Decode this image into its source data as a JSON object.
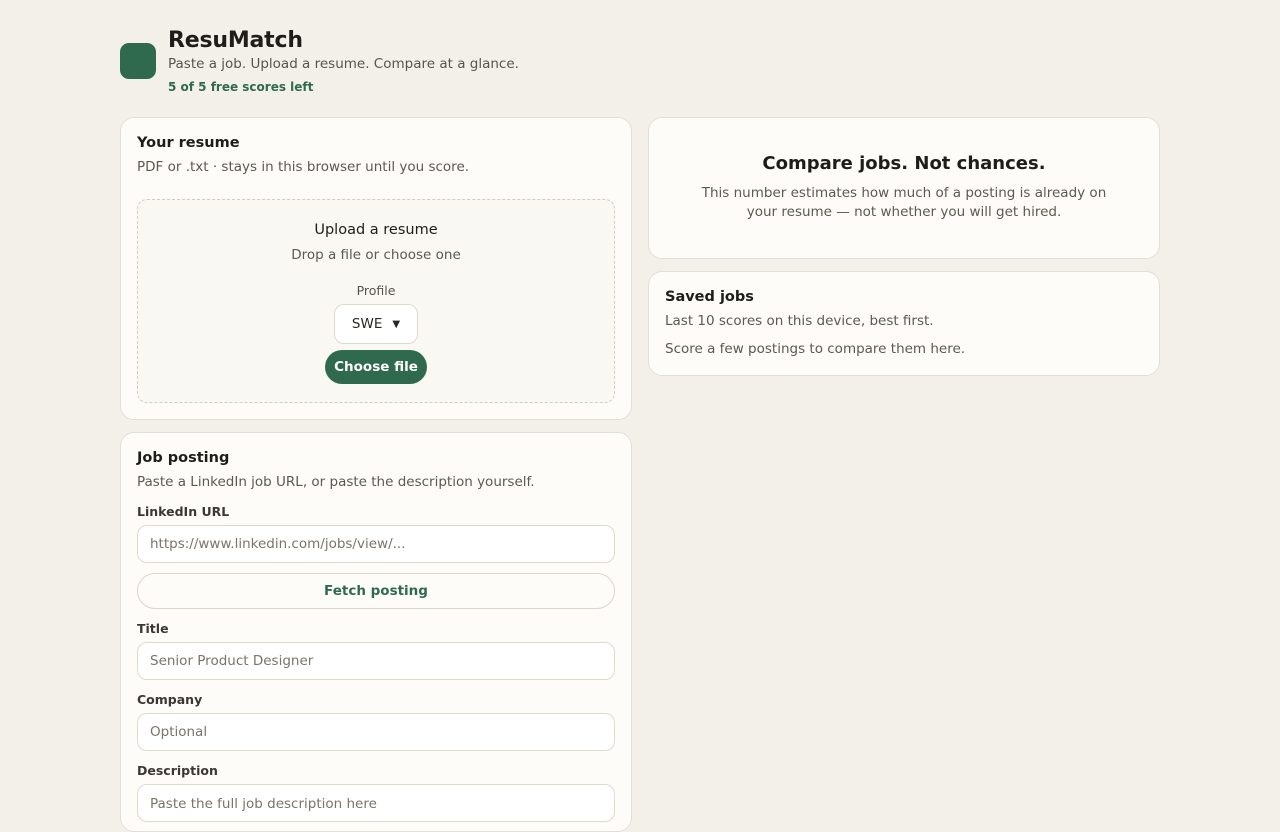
{
  "header": {
    "title": "ResuMatch",
    "tagline": "Paste a job. Upload a resume. Compare at a glance.",
    "quota": "5 of 5 free scores left"
  },
  "resume": {
    "title": "Your resume",
    "subtitle": "PDF or .txt · stays in this browser until you score.",
    "upload_title": "Upload a resume",
    "upload_subtitle": "Drop a file or choose one",
    "profile_label": "Profile",
    "profile_value": "SWE",
    "choose_label": "Choose file"
  },
  "job": {
    "title": "Job posting",
    "subtitle": "Paste a LinkedIn job URL, or paste the description yourself.",
    "url_label": "LinkedIn URL",
    "url_placeholder": "https://www.linkedin.com/jobs/view/...",
    "fetch_label": "Fetch posting",
    "title_label": "Title",
    "title_placeholder": "Senior Product Designer",
    "company_label": "Company",
    "company_placeholder": "Optional",
    "description_label": "Description",
    "description_placeholder": "Paste the full job description here"
  },
  "compare": {
    "title": "Compare jobs. Not chances.",
    "text": "This number estimates how much of a posting is already on your resume — not whether you will get hired."
  },
  "saved": {
    "title": "Saved jobs",
    "subtitle": "Last 10 scores on this device, best first.",
    "empty": "Score a few postings to compare them here."
  }
}
